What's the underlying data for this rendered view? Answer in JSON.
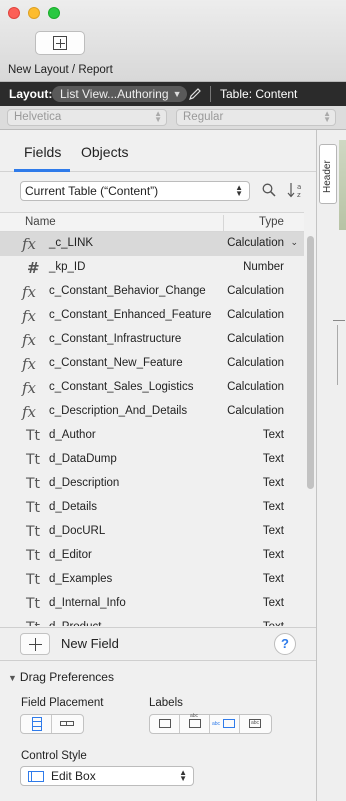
{
  "toolbar": {
    "new_layout_label": "New Layout / Report"
  },
  "layout_bar": {
    "layout_label": "Layout:",
    "layout_value": "List View...Authoring",
    "table_label": "Table: Content"
  },
  "font_bar": {
    "font_family": "Helvetica",
    "font_style": "Regular"
  },
  "side_strip": {
    "header_tab_label": "Header"
  },
  "panel": {
    "tabs": [
      {
        "label": "Fields",
        "active": true
      },
      {
        "label": "Objects",
        "active": false
      }
    ],
    "table_select_value": "Current Table (“Content”)",
    "columns": {
      "name": "Name",
      "type": "Type"
    },
    "fields": [
      {
        "icon": "calculation-icon",
        "glyph": "fx",
        "name": "_c_LINK",
        "type": "Calculation",
        "selected": true
      },
      {
        "icon": "number-icon",
        "glyph": "#",
        "name": "_kp_ID",
        "type": "Number",
        "selected": false
      },
      {
        "icon": "calculation-icon",
        "glyph": "fx",
        "name": "c_Constant_Behavior_Change",
        "type": "Calculation",
        "selected": false
      },
      {
        "icon": "calculation-icon",
        "glyph": "fx",
        "name": "c_Constant_Enhanced_Feature",
        "type": "Calculation",
        "selected": false
      },
      {
        "icon": "calculation-icon",
        "glyph": "fx",
        "name": "c_Constant_Infrastructure",
        "type": "Calculation",
        "selected": false
      },
      {
        "icon": "calculation-icon",
        "glyph": "fx",
        "name": "c_Constant_New_Feature",
        "type": "Calculation",
        "selected": false
      },
      {
        "icon": "calculation-icon",
        "glyph": "fx",
        "name": "c_Constant_Sales_Logistics",
        "type": "Calculation",
        "selected": false
      },
      {
        "icon": "calculation-icon",
        "glyph": "fx",
        "name": "c_Description_And_Details",
        "type": "Calculation",
        "selected": false
      },
      {
        "icon": "text-icon",
        "glyph": "Tt",
        "name": "d_Author",
        "type": "Text",
        "selected": false
      },
      {
        "icon": "text-icon",
        "glyph": "Tt",
        "name": "d_DataDump",
        "type": "Text",
        "selected": false
      },
      {
        "icon": "text-icon",
        "glyph": "Tt",
        "name": "d_Description",
        "type": "Text",
        "selected": false
      },
      {
        "icon": "text-icon",
        "glyph": "Tt",
        "name": "d_Details",
        "type": "Text",
        "selected": false
      },
      {
        "icon": "text-icon",
        "glyph": "Tt",
        "name": "d_DocURL",
        "type": "Text",
        "selected": false
      },
      {
        "icon": "text-icon",
        "glyph": "Tt",
        "name": "d_Editor",
        "type": "Text",
        "selected": false
      },
      {
        "icon": "text-icon",
        "glyph": "Tt",
        "name": "d_Examples",
        "type": "Text",
        "selected": false
      },
      {
        "icon": "text-icon",
        "glyph": "Tt",
        "name": "d_Internal_Info",
        "type": "Text",
        "selected": false
      },
      {
        "icon": "text-icon",
        "glyph": "Tt",
        "name": "d_Product",
        "type": "Text",
        "selected": false
      }
    ],
    "new_field_label": "New Field",
    "help_label": "?"
  },
  "drag_preferences": {
    "title": "Drag Preferences",
    "field_placement_label": "Field Placement",
    "labels_label": "Labels",
    "control_style_label": "Control Style",
    "control_style_value": "Edit Box"
  },
  "colors": {
    "accent": "#2f7bea",
    "selected_row": "#d9d9d9",
    "layout_bar": "#2b2b2b"
  }
}
